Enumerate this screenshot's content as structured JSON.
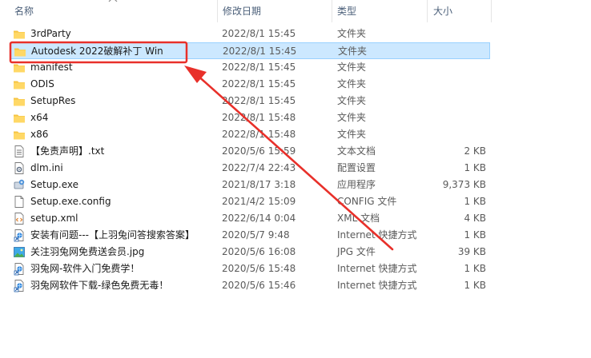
{
  "columns": {
    "name": "名称",
    "date": "修改日期",
    "type": "类型",
    "size": "大小"
  },
  "colors": {
    "folder": "#f6c443",
    "selected_bg": "#cce8ff",
    "annotation": "#e8302a"
  },
  "rows": [
    {
      "name": "3rdParty",
      "date": "2022/8/1 15:45",
      "type": "文件夹",
      "size": "",
      "icon": "folder-icon"
    },
    {
      "name": "Autodesk 2022破解补丁 Win",
      "date": "2022/8/1 15:45",
      "type": "文件夹",
      "size": "",
      "icon": "folder-icon",
      "selected": true
    },
    {
      "name": "manifest",
      "date": "2022/8/1 15:45",
      "type": "文件夹",
      "size": "",
      "icon": "folder-icon"
    },
    {
      "name": "ODIS",
      "date": "2022/8/1 15:45",
      "type": "文件夹",
      "size": "",
      "icon": "folder-icon"
    },
    {
      "name": "SetupRes",
      "date": "2022/8/1 15:45",
      "type": "文件夹",
      "size": "",
      "icon": "folder-icon"
    },
    {
      "name": "x64",
      "date": "2022/8/1 15:48",
      "type": "文件夹",
      "size": "",
      "icon": "folder-icon"
    },
    {
      "name": "x86",
      "date": "2022/8/1 15:48",
      "type": "文件夹",
      "size": "",
      "icon": "folder-icon"
    },
    {
      "name": "【免责声明】.txt",
      "date": "2020/5/6 15:59",
      "type": "文本文档",
      "size": "2 KB",
      "icon": "text-file-icon"
    },
    {
      "name": "dlm.ini",
      "date": "2022/7/4 22:43",
      "type": "配置设置",
      "size": "1 KB",
      "icon": "settings-file-icon"
    },
    {
      "name": "Setup.exe",
      "date": "2021/8/17 3:18",
      "type": "应用程序",
      "size": "9,373 KB",
      "icon": "setup-exe-icon"
    },
    {
      "name": "Setup.exe.config",
      "date": "2021/4/2 15:09",
      "type": "CONFIG 文件",
      "size": "1 KB",
      "icon": "blank-file-icon"
    },
    {
      "name": "setup.xml",
      "date": "2022/6/14 0:04",
      "type": "XML 文档",
      "size": "4 KB",
      "icon": "xml-file-icon"
    },
    {
      "name": "安装有问题---【上羽兔问答搜索答案】",
      "date": "2020/5/7 9:48",
      "type": "Internet 快捷方式",
      "size": "1 KB",
      "icon": "internet-shortcut-icon"
    },
    {
      "name": "关注羽兔网免费送会员.jpg",
      "date": "2020/5/6 16:08",
      "type": "JPG 文件",
      "size": "39 KB",
      "icon": "image-file-icon"
    },
    {
      "name": "羽兔网-软件入门免费学！",
      "date": "2020/5/6 15:48",
      "type": "Internet 快捷方式",
      "size": "1 KB",
      "icon": "internet-shortcut-icon"
    },
    {
      "name": "羽兔网软件下载-绿色免费无毒！",
      "date": "2020/5/6 15:46",
      "type": "Internet 快捷方式",
      "size": "1 KB",
      "icon": "internet-shortcut-icon"
    }
  ]
}
